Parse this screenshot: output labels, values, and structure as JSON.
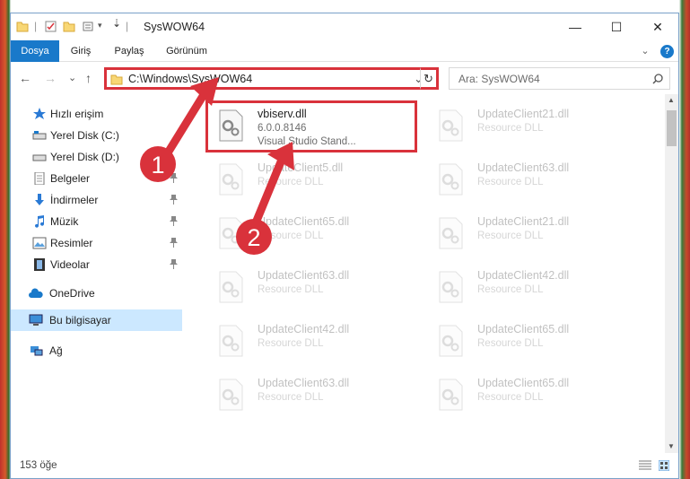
{
  "window": {
    "title": "SysWOW64",
    "minimize": "—",
    "maximize": "☐",
    "close": "✕"
  },
  "ribbon": {
    "tabs": [
      "Dosya",
      "Giriş",
      "Paylaş",
      "Görünüm"
    ],
    "expand": "⌄",
    "help": "?"
  },
  "navigation": {
    "back": "←",
    "forward": "→",
    "recent": "⌄",
    "up": "↑",
    "address": "C:\\Windows\\SysWOW64",
    "address_dropdown": "⌄",
    "refresh": "↻",
    "search_placeholder": "Ara: SysWOW64"
  },
  "sidebar": {
    "items": [
      {
        "label": "Hızlı erişim",
        "icon": "star-icon"
      },
      {
        "label": "Yerel Disk (C:)",
        "icon": "drive-icon"
      },
      {
        "label": "Yerel Disk (D:)",
        "icon": "drive-icon"
      },
      {
        "label": "Belgeler",
        "icon": "documents-icon"
      },
      {
        "label": "İndirmeler",
        "icon": "download-icon"
      },
      {
        "label": "Müzik",
        "icon": "music-icon"
      },
      {
        "label": "Resimler",
        "icon": "pictures-icon"
      },
      {
        "label": "Videolar",
        "icon": "videos-icon"
      },
      {
        "label": "OneDrive",
        "icon": "cloud-icon"
      },
      {
        "label": "Bu bilgisayar",
        "icon": "computer-icon"
      },
      {
        "label": "Ağ",
        "icon": "network-icon"
      }
    ]
  },
  "files": [
    {
      "name": "vbiserv.dll",
      "version": "6.0.0.8146",
      "description": "Visual Studio Stand..."
    },
    {
      "name": "UpdateClient21.dll",
      "type": "Resource DLL"
    },
    {
      "name": "UpdateClient5.dll",
      "type": "Resource DLL"
    },
    {
      "name": "UpdateClient63.dll",
      "type": "Resource DLL"
    },
    {
      "name": "UpdateClient65.dll",
      "type": "Resource DLL"
    },
    {
      "name": "UpdateClient21.dll",
      "type": "Resource DLL"
    },
    {
      "name": "UpdateClient63.dll",
      "type": "Resource DLL"
    },
    {
      "name": "UpdateClient42.dll",
      "type": "Resource DLL"
    },
    {
      "name": "UpdateClient42.dll",
      "type": "Resource DLL"
    },
    {
      "name": "UpdateClient65.dll",
      "type": "Resource DLL"
    },
    {
      "name": "UpdateClient63.dll",
      "type": "Resource DLL"
    },
    {
      "name": "UpdateClient65.dll",
      "type": "Resource DLL"
    }
  ],
  "status": {
    "count": "153 öğe"
  },
  "annotations": {
    "step1": "1",
    "step2": "2",
    "color": "#d9323b"
  },
  "colors": {
    "accent": "#1979ca",
    "selection": "#cce8ff",
    "highlight": "#d9323b"
  }
}
